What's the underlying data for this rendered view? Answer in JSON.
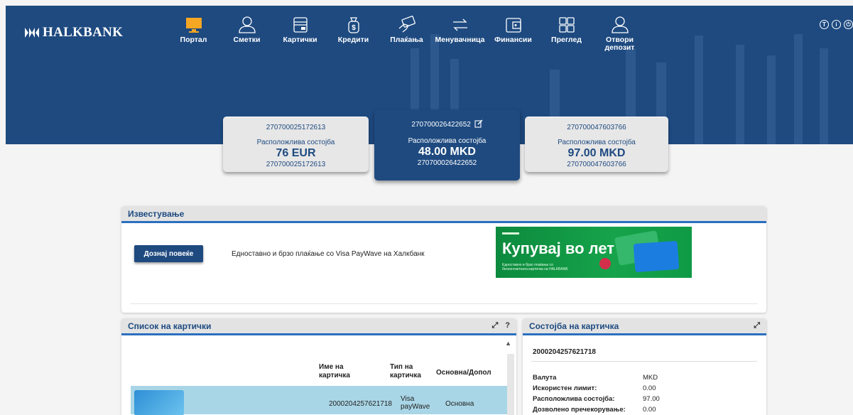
{
  "brand": {
    "logo_text": "HALKBANK"
  },
  "nav": [
    {
      "label": "Портал",
      "icon": "monitor-icon",
      "active": true
    },
    {
      "label": "Сметки",
      "icon": "user-icon"
    },
    {
      "label": "Картички",
      "icon": "wallet-card-icon"
    },
    {
      "label": "Кредити",
      "icon": "money-bag-icon"
    },
    {
      "label": "Плаќања",
      "icon": "hand-card-icon"
    },
    {
      "label": "Менувачница",
      "icon": "exchange-arrows-icon"
    },
    {
      "label": "Финансии",
      "icon": "wallet-icon"
    },
    {
      "label": "Преглед",
      "icon": "grid-icon"
    },
    {
      "label": "Отвори депозит",
      "icon": "user-add-icon"
    }
  ],
  "top_icons": [
    "T",
    "i",
    "⏻"
  ],
  "accounts": [
    {
      "number": "270700025172613",
      "available_label": "Расположлива состојба",
      "amount": "76 EUR",
      "sub_number": "270700025172613"
    },
    {
      "number": "270700026422652",
      "available_label": "Расположлива состојба",
      "amount": "48.00 MKD",
      "sub_number": "270700026422652"
    },
    {
      "number": "270700047603766",
      "available_label": "Расположлива состојба",
      "amount": "97.00 MKD",
      "sub_number": "270700047603766"
    }
  ],
  "notice": {
    "title": "Известување",
    "button": "Дознај повеќе",
    "text": "Едноставно и брзо плаќање со Visa PayWave на Халкбанк",
    "banner_title": "Купувај во лет",
    "banner_sub1": "Едноставно и брзо плаќање со",
    "banner_sub2": "бесконтактната картичка на HALKBANK"
  },
  "card_list": {
    "title": "Список на картички",
    "tools": [
      "⤢",
      "?"
    ],
    "col_name": "Име на картичка",
    "col_type": "Тип на картичка",
    "col_main": "Основна/Допол",
    "rows": [
      {
        "name": "2000204257621718",
        "type": "Visa payWave",
        "main": "Основна"
      }
    ]
  },
  "card_status": {
    "title": "Состојба на картичка",
    "tools": [
      "⤢"
    ],
    "card_number": "2000204257621718",
    "rows": [
      {
        "label": "Валута",
        "value": "MKD"
      },
      {
        "label": "Искористен лимит:",
        "value": "0.00"
      },
      {
        "label": "Расположлива состојба:",
        "value": "97.00"
      },
      {
        "label": "Дозволено пречекорување:",
        "value": "0.00"
      }
    ]
  }
}
